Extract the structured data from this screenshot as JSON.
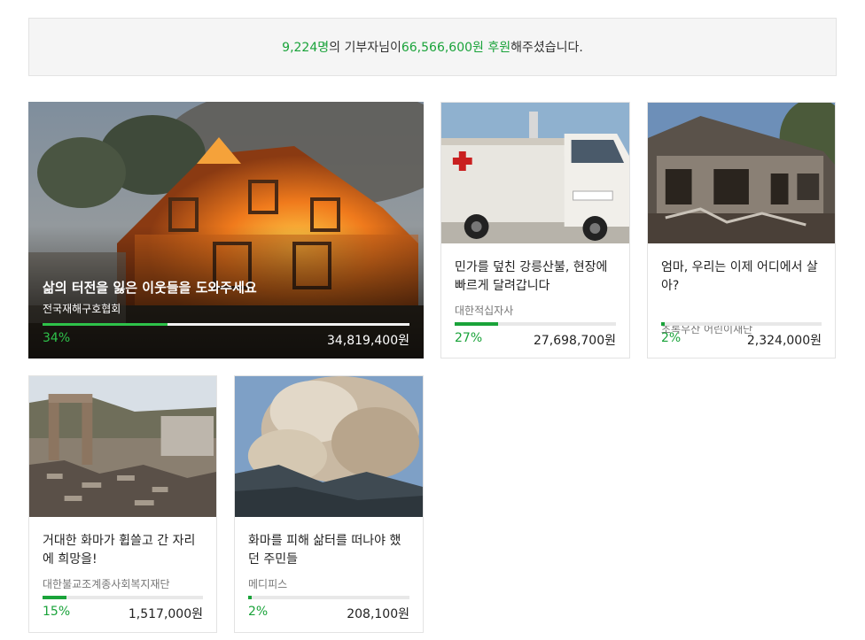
{
  "summary": {
    "donors": "9,224명",
    "text1": "의 기부자님이 ",
    "amount": "66,566,600원 후원",
    "text2": "해주셨습니다."
  },
  "cards": [
    {
      "title": "삶의 터전을 잃은 이웃들을 도와주세요",
      "org": "전국재해구호협회",
      "percent_label": "34%",
      "progress": 0.34,
      "amount": "34,819,400원",
      "image": "house-fire-photo"
    },
    {
      "title": "민가를 덮친 강릉산불, 현장에 빠르게 달려갑니다",
      "org": "대한적십자사",
      "percent_label": "27%",
      "progress": 0.27,
      "amount": "27,698,700원",
      "image": "red-cross-truck-photo"
    },
    {
      "title": "엄마, 우리는 이제 어디에서 살아?",
      "org": "초록우산 어린이재단",
      "percent_label": "2%",
      "progress": 0.02,
      "amount": "2,324,000원",
      "image": "burned-house-photo"
    },
    {
      "title": "거대한 화마가 휩쓸고 간 자리에 희망을!",
      "org": "대한불교조계종사회복지재단",
      "percent_label": "15%",
      "progress": 0.15,
      "amount": "1,517,000원",
      "image": "ruins-photo"
    },
    {
      "title": "화마를 피해 삶터를 떠나야 했던 주민들",
      "org": "메디피스",
      "percent_label": "2%",
      "progress": 0.02,
      "amount": "208,100원",
      "image": "smoke-plume-photo"
    }
  ],
  "colors": {
    "accent": "#1aa33a",
    "border": "#e3e3e3",
    "summary_bg": "#f5f5f5"
  }
}
